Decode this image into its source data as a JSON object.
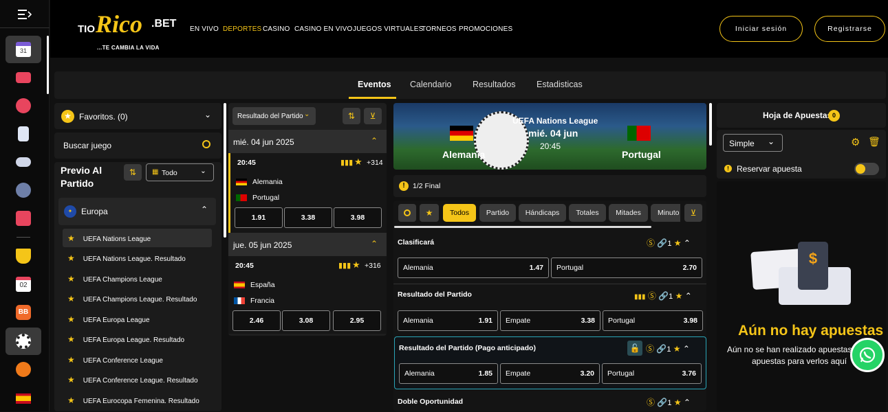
{
  "header": {
    "logo_tio": "TIO",
    "logo_rico": "Rico",
    "logo_bet": ".BET",
    "logo_tagline": "...TE CAMBIA LA VIDA",
    "nav": [
      "EN VIVO",
      "DEPORTES",
      "CASINO",
      "CASINO EN VIVO",
      "JUEGOS VIRTUALES",
      "TORNEOS",
      "PROMOCIONES"
    ],
    "login": "Iniciar sesión",
    "register": "Registrarse"
  },
  "tabs": [
    "Eventos",
    "Calendario",
    "Resultados",
    "Estadisticas"
  ],
  "left": {
    "favorites": "Favoritos. (0)",
    "search": "Buscar juego",
    "prematch": "Previo Al Partido",
    "filter": "Todo",
    "region": "Europa",
    "leagues": [
      "UEFA Nations League",
      "UEFA Nations League. Resultado",
      "UEFA Champions League",
      "UEFA Champions League. Resultado",
      "UEFA Europa League",
      "UEFA Europa League. Resultado",
      "UEFA Conference League",
      "UEFA Conference League. Resultado",
      "UEFA Eurocopa Femenina. Resultado"
    ]
  },
  "middle": {
    "market": "Resultado del Partido",
    "days": [
      {
        "date": "mié. 04 jun 2025",
        "time": "20:45",
        "more": "+314",
        "team1": "Alemania",
        "team2": "Portugal",
        "odds": [
          "1.91",
          "3.38",
          "3.98"
        ]
      },
      {
        "date": "jue. 05 jun 2025",
        "time": "20:45",
        "more": "+316",
        "team1": "España",
        "team2": "Francia",
        "odds": [
          "2.46",
          "3.08",
          "2.95"
        ]
      }
    ]
  },
  "match": {
    "league": "UEFA Nations League",
    "date": "mié. 04 jun",
    "time": "20:45",
    "home": "Alemania",
    "away": "Portugal",
    "stage": "1/2 Final",
    "filters": [
      "Todos",
      "Partido",
      "Hándicaps",
      "Totales",
      "Mitades",
      "Minuto"
    ],
    "markets": [
      {
        "title": "Clasificará",
        "count": "1",
        "odds": [
          {
            "name": "Alemania",
            "value": "1.47"
          },
          {
            "name": "Portugal",
            "value": "2.70"
          }
        ]
      },
      {
        "title": "Resultado del Partido",
        "count": "1",
        "odds": [
          {
            "name": "Alemania",
            "value": "1.91"
          },
          {
            "name": "Empate",
            "value": "3.38"
          },
          {
            "name": "Portugal",
            "value": "3.98"
          }
        ]
      },
      {
        "title": "Resultado del Partido (Pago anticipado)",
        "count": "1",
        "odds": [
          {
            "name": "Alemania",
            "value": "1.85"
          },
          {
            "name": "Empate",
            "value": "3.20"
          },
          {
            "name": "Portugal",
            "value": "3.76"
          }
        ]
      },
      {
        "title": "Doble Oportunidad",
        "count": "1",
        "odds": []
      }
    ]
  },
  "betslip": {
    "title": "Hoja de Apuestas",
    "count": "0",
    "type": "Simple",
    "reserve": "Reservar apuesta",
    "empty_title": "Aún no hay apuestas",
    "empty_text1": "Aún no se han realizado apuestas. I",
    "empty_text2": "apuestas para verlos aquí"
  },
  "colors": {
    "accent": "#f5c518",
    "bg": "#111111",
    "panel": "#1b1b1b"
  },
  "rail_icons": [
    "menu-icon",
    "calendar-icon",
    "live-video-icon",
    "casino-icon",
    "cards-icon",
    "gamepad-icon",
    "sports-mix-icon",
    "gift-icon",
    "trophy-icon",
    "calendar-02-icon",
    "bb-icon",
    "soccer-ball-icon",
    "basketball-icon",
    "spain-flag-icon"
  ]
}
